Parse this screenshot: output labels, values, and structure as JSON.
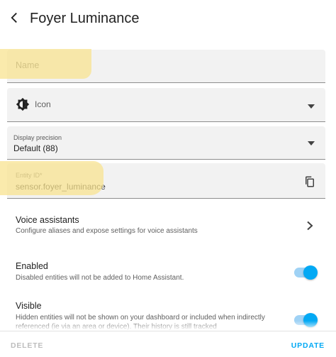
{
  "header": {
    "title": "Foyer Luminance"
  },
  "form": {
    "name": {
      "placeholder": "Name"
    },
    "icon": {
      "label": "Icon",
      "icon_name": "brightness-icon"
    },
    "display_precision": {
      "label": "Display precision",
      "value": "Default (88)"
    },
    "entity_id": {
      "label": "Entity ID*",
      "value": "sensor.foyer_luminance"
    }
  },
  "voice_assistants": {
    "title": "Voice assistants",
    "subtitle": "Configure aliases and expose settings for voice assistants"
  },
  "enabled": {
    "title": "Enabled",
    "subtitle": "Disabled entities will not be added to Home Assistant.",
    "checked": true
  },
  "visible": {
    "title": "Visible",
    "subtitle": "Hidden entities will not be shown on your dashboard or included when indirectly referenced (ie via an area or device). Their history is still tracked",
    "checked": true
  },
  "footer": {
    "delete_label": "DELETE",
    "update_label": "UPDATE"
  },
  "colors": {
    "accent": "#03a9f4",
    "highlight": "#f8e28c",
    "field_background": "#f2f2f2"
  }
}
